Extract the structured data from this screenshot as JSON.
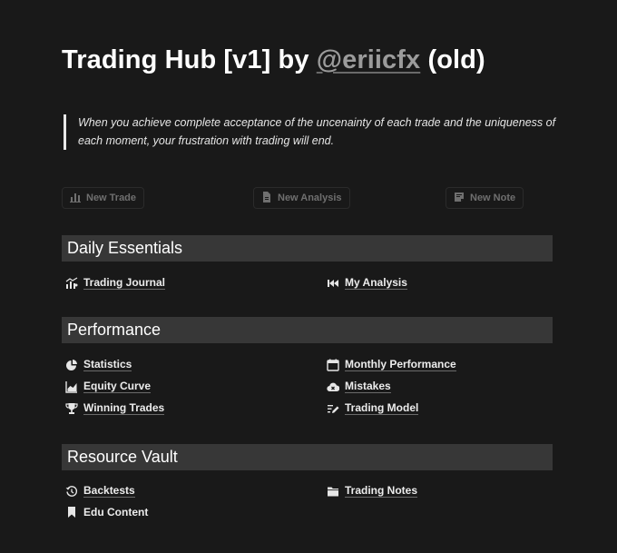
{
  "title": {
    "prefix": "Trading Hub [v1] by ",
    "mention": "@eriicfx",
    "suffix": " (old)"
  },
  "quote": "When you achieve complete acceptance of the uncenainty of each trade and the uniqueness of each moment, your frustration with trading will end.",
  "buttons": [
    {
      "label": "New Trade",
      "icon": "bar-chart-icon"
    },
    {
      "label": "New Analysis",
      "icon": "document-icon"
    },
    {
      "label": "New Note",
      "icon": "note-icon"
    }
  ],
  "sections": {
    "daily": {
      "title": "Daily Essentials",
      "items": [
        {
          "label": "Trading Journal",
          "icon": "chart-people-icon"
        },
        {
          "label": "My Analysis",
          "icon": "rewind-icon"
        }
      ]
    },
    "performance": {
      "title": "Performance",
      "items": [
        {
          "label": "Statistics",
          "icon": "pie-chart-icon"
        },
        {
          "label": "Monthly Performance",
          "icon": "calendar-icon"
        },
        {
          "label": "Equity Curve",
          "icon": "area-chart-icon"
        },
        {
          "label": "Mistakes",
          "icon": "cloud-x-icon"
        },
        {
          "label": "Winning Trades",
          "icon": "trophy-icon"
        },
        {
          "label": "Trading Model",
          "icon": "lines-pen-icon"
        }
      ]
    },
    "resources": {
      "title": "Resource Vault",
      "items": [
        {
          "label": "Backtests",
          "icon": "history-icon"
        },
        {
          "label": "Trading Notes",
          "icon": "folder-icon"
        },
        {
          "label": "Edu Content",
          "icon": "bookmark-icon"
        }
      ]
    }
  }
}
